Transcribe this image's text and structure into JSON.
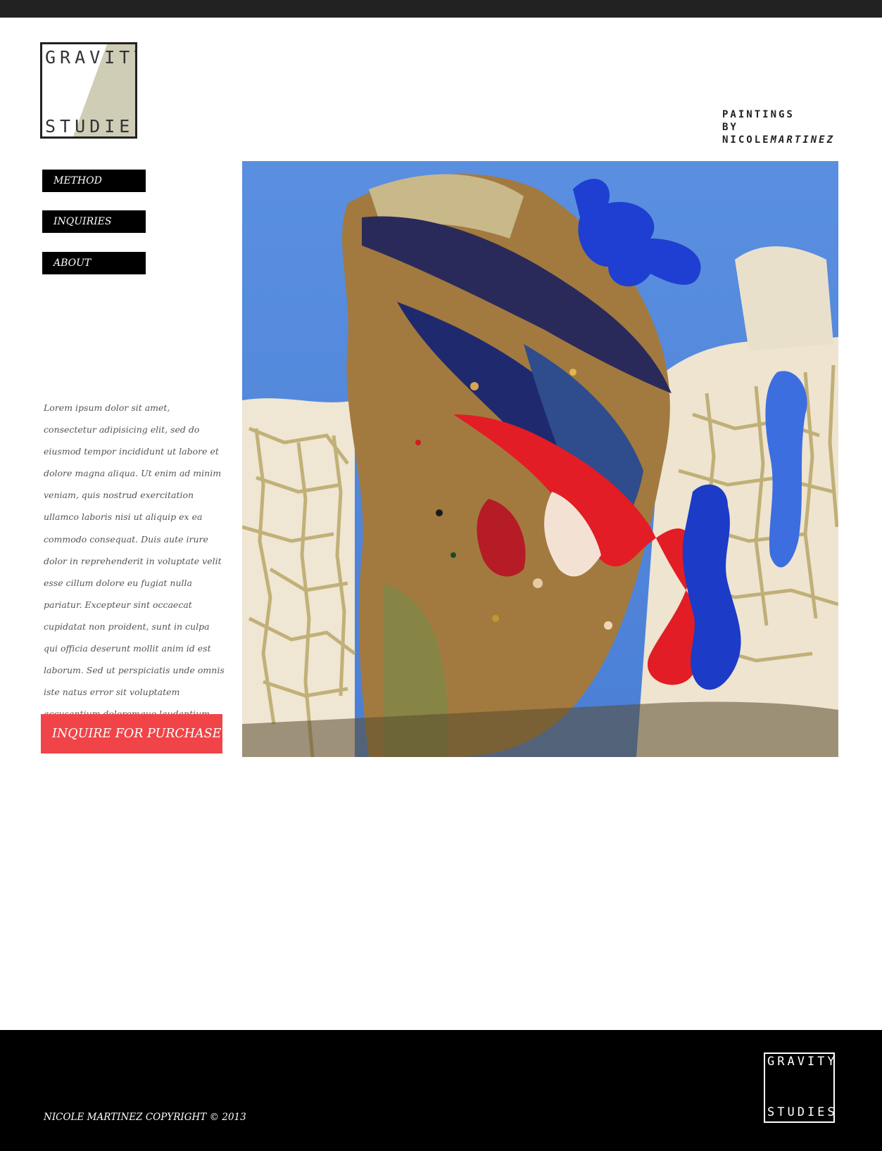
{
  "colors": {
    "topbar": "#222222",
    "nav_bg": "#000000",
    "cta_bg": "#f04448",
    "footer_bg": "#000000",
    "logo_accent": "#cfcdb5"
  },
  "logo": {
    "line1": "GRAVITY",
    "line2": "STUDIES"
  },
  "tagline": {
    "line1": "PAINTINGS",
    "line2": "BY",
    "first_name": "NICOLE",
    "last_name": "MARTINEZ"
  },
  "nav": {
    "items": [
      {
        "label": "METHOD"
      },
      {
        "label": "INQUIRIES"
      },
      {
        "label": "ABOUT"
      }
    ]
  },
  "main": {
    "description": "Lorem ipsum dolor sit amet, consectetur adipisicing elit, sed do eiusmod tempor incididunt ut labore et dolore magna aliqua. Ut enim ad minim veniam, quis nostrud exercitation ullamco laboris nisi ut aliquip ex ea commodo consequat. Duis aute irure dolor in reprehenderit in voluptate velit esse cillum dolore eu fugiat nulla pariatur. Excepteur sint occaecat cupidatat non proident, sunt in culpa qui officia deserunt mollit anim id est laborum. Sed ut perspiciatis unde omnis iste natus error sit voluptatem accusantium doloremque laudantium,",
    "cta_label": "INQUIRE FOR PURCHASE"
  },
  "footer": {
    "copyright": "NICOLE MARTINEZ COPYRIGHT © 2013",
    "logo_line1": "GRAVITY",
    "logo_line2": "STUDIES"
  }
}
